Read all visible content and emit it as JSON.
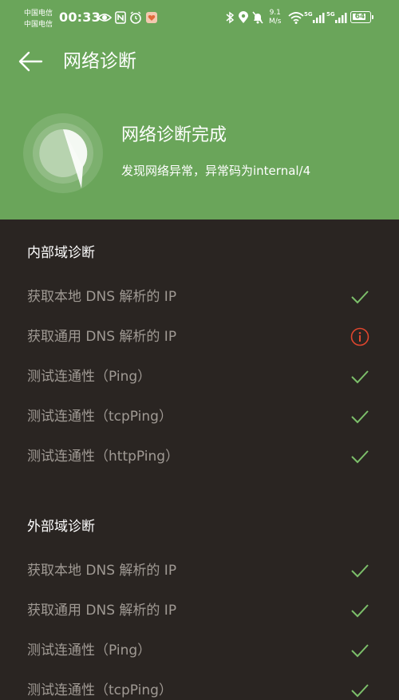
{
  "status_bar": {
    "carrier1": "中国电信",
    "carrier2": "中国电信",
    "time": "00:33",
    "net_speed_value": "9.1",
    "net_speed_unit": "M/s",
    "signal1_label": "5G",
    "signal2_label": "5G",
    "battery": "64"
  },
  "header": {
    "title": "网络诊断"
  },
  "result": {
    "title": "网络诊断完成",
    "subtitle": "发现网络异常，异常码为internal/4"
  },
  "sections": [
    {
      "title": "内部域诊断",
      "items": [
        {
          "label": "获取本地 DNS 解析的 IP",
          "status": "ok"
        },
        {
          "label": "获取通用 DNS 解析的 IP",
          "status": "error"
        },
        {
          "label": "测试连通性（Ping）",
          "status": "ok"
        },
        {
          "label": "测试连通性（tcpPing）",
          "status": "ok"
        },
        {
          "label": "测试连通性（httpPing）",
          "status": "ok"
        }
      ]
    },
    {
      "title": "外部域诊断",
      "items": [
        {
          "label": "获取本地 DNS 解析的 IP",
          "status": "ok"
        },
        {
          "label": "获取通用 DNS 解析的 IP",
          "status": "ok"
        },
        {
          "label": "测试连通性（Ping）",
          "status": "ok"
        },
        {
          "label": "测试连通性（tcpPing）",
          "status": "ok"
        }
      ]
    }
  ],
  "colors": {
    "header_bg": "#6aa55a",
    "body_bg": "#2a2522",
    "ok": "#7cbf6a",
    "error": "#e0462e"
  }
}
